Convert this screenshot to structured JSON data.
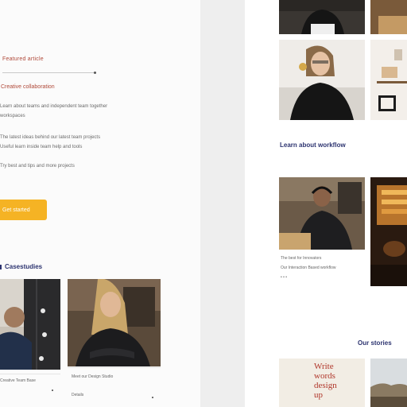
{
  "left_column": {
    "eyebrow": "Featured article",
    "subhead": "Creative collaboration",
    "body_lines": [
      "Learn about teams and independent team together",
      "workspaces",
      "The latest ideas behind our latest team projects",
      "Useful learn inside team help and tools",
      "Try best and tips and more projects"
    ],
    "cta_label": "Get started",
    "section_title": "Casestudies",
    "cards": [
      {
        "caption": "Creative Team Base"
      },
      {
        "caption": "Meet our Design Studio",
        "caption2": "Details"
      }
    ]
  },
  "right_column": {
    "section_title": "Learn about workflow",
    "card_captions": [
      "The best for Innovators",
      "Our Interaction Based workflow"
    ],
    "footer_title": "Our stories",
    "poster_text": "Write words design up"
  }
}
